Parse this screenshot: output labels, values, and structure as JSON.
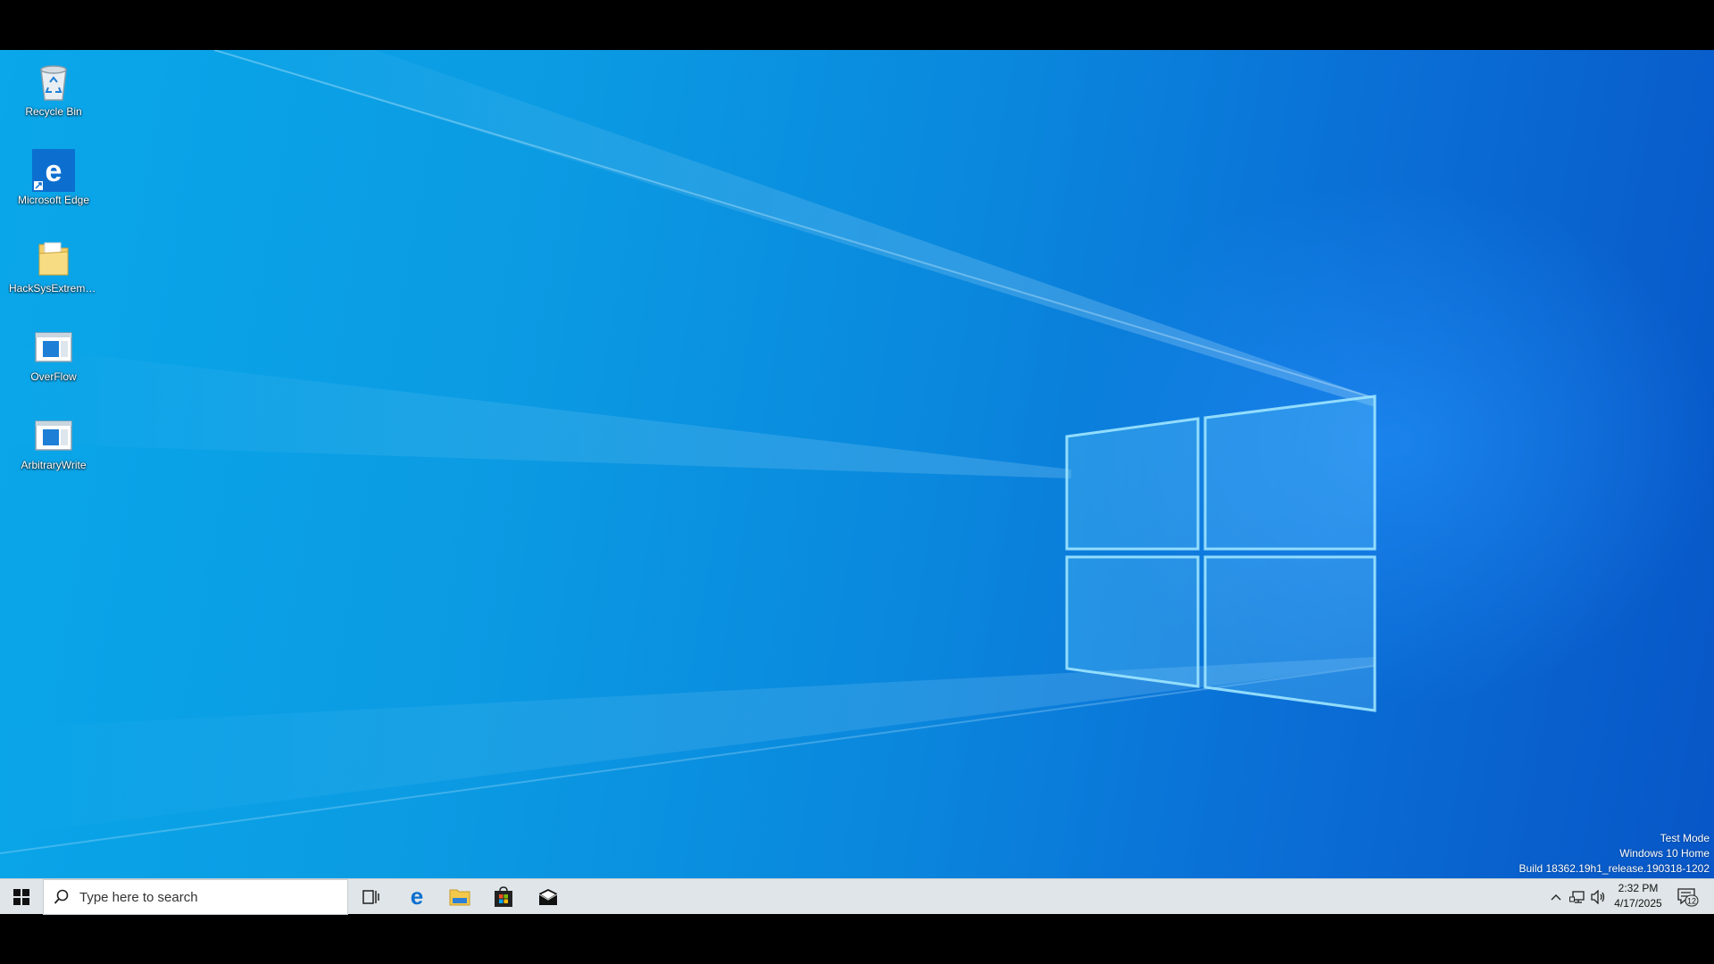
{
  "desktop": {
    "icons": [
      {
        "label": "Recycle Bin",
        "icon": "recycle-bin-icon"
      },
      {
        "label": "Microsoft Edge",
        "icon": "edge-shortcut-icon"
      },
      {
        "label": "HackSysExtremeVu...",
        "icon": "folder-icon"
      },
      {
        "label": "OverFlow",
        "icon": "application-window-icon"
      },
      {
        "label": "ArbitraryWrite",
        "icon": "application-window-icon"
      }
    ],
    "watermark": {
      "line1": "Test Mode",
      "line2": "Windows 10 Home",
      "line3": "Build 18362.19h1_release.190318-1202"
    }
  },
  "taskbar": {
    "search_placeholder": "Type here to search",
    "pinned": [
      "Task View",
      "Microsoft Edge",
      "File Explorer",
      "Microsoft Store",
      "Mail"
    ],
    "clock": {
      "time": "2:32 PM",
      "date": "4/17/2025"
    },
    "notification_count": "12"
  },
  "colors": {
    "desktop_accent": "#0a87dd",
    "taskbar_bg": "#dfe5e8",
    "edge_blue": "#0c6fcf"
  }
}
